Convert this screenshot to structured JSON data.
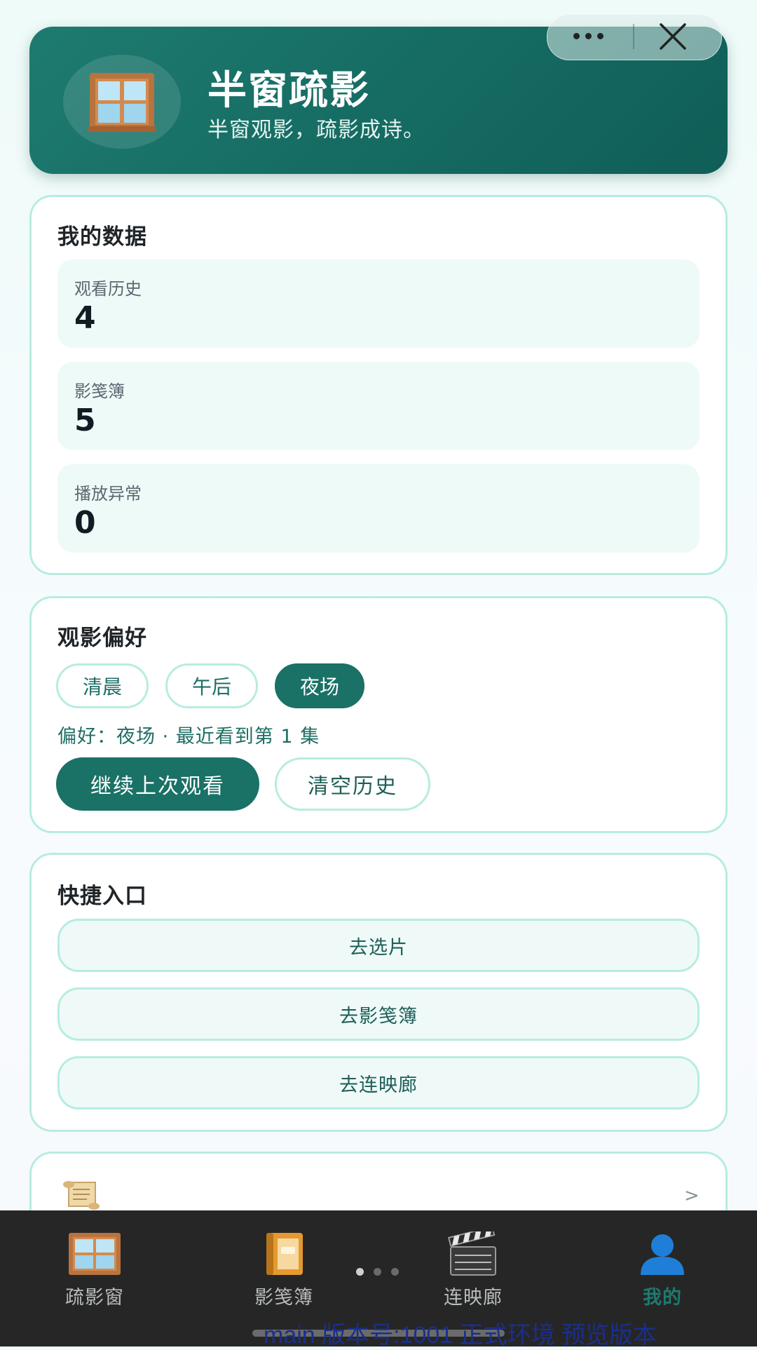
{
  "header": {
    "title": "半窗疏影",
    "subtitle": "半窗观影，疏影成诗。",
    "avatar_icon": "window-icon"
  },
  "capsule": {
    "more_icon": "more-dots-icon",
    "close_icon": "close-icon"
  },
  "my_data": {
    "title": "我的数据",
    "stats": [
      {
        "label": "观看历史",
        "value": "4"
      },
      {
        "label": "影笺簿",
        "value": "5"
      },
      {
        "label": "播放异常",
        "value": "0"
      }
    ]
  },
  "preference": {
    "title": "观影偏好",
    "chips": [
      {
        "label": "清晨",
        "active": false
      },
      {
        "label": "午后",
        "active": false
      },
      {
        "label": "夜场",
        "active": true
      }
    ],
    "summary": "偏好：夜场 · 最近看到第 1 集",
    "continue_label": "继续上次观看",
    "clear_label": "清空历史"
  },
  "quick": {
    "title": "快捷入口",
    "items": [
      "去选片",
      "去影笺簿",
      "去连映廊"
    ]
  },
  "partial_card": {
    "icon": "scroll-icon",
    "chevron": ">"
  },
  "tabbar": {
    "items": [
      {
        "label": "疏影窗",
        "icon": "window-icon",
        "active": false
      },
      {
        "label": "影笺簿",
        "icon": "notebook-icon",
        "active": false
      },
      {
        "label": "连映廊",
        "icon": "clapperboard-icon",
        "active": false
      },
      {
        "label": "我的",
        "icon": "user-icon",
        "active": true
      }
    ]
  },
  "footer": {
    "version_text": "main 版本号:1001 正式环境 预览版本"
  },
  "colors": {
    "accent": "#1a7166",
    "border": "#b7ece1",
    "tab_active": "#1e7a6f",
    "tabbar_bg": "#262626"
  }
}
